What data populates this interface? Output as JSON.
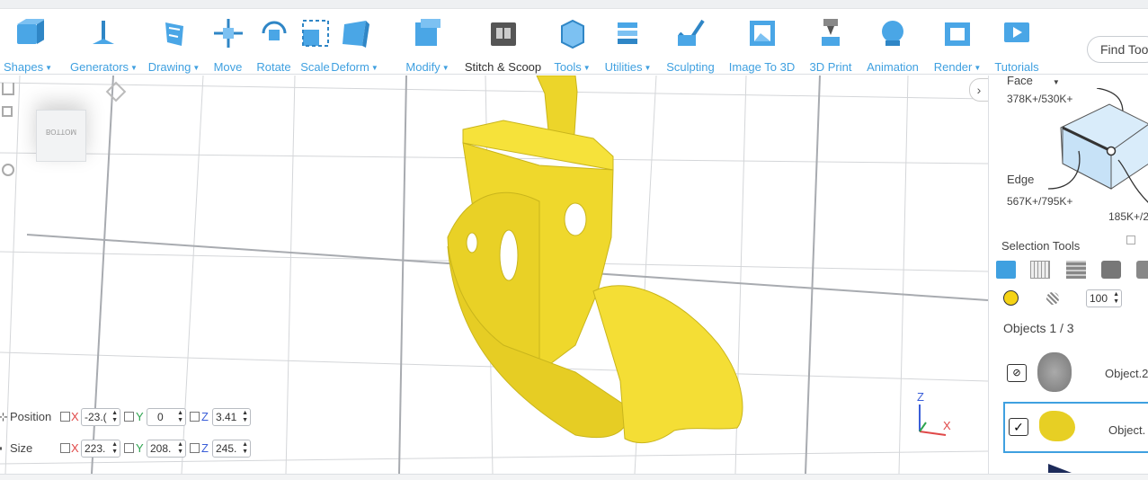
{
  "toolbar": {
    "items": [
      {
        "label": "Shapes",
        "dropdown": true,
        "icon": "cube-icon"
      },
      {
        "label": "Generators",
        "dropdown": true,
        "icon": "generator-icon"
      },
      {
        "label": "Drawing",
        "dropdown": true,
        "icon": "drawing-icon"
      },
      {
        "label": "Move",
        "dropdown": false,
        "icon": "move-icon"
      },
      {
        "label": "Rotate",
        "dropdown": false,
        "icon": "rotate-icon"
      },
      {
        "label": "Scale",
        "dropdown": false,
        "icon": "scale-icon"
      },
      {
        "label": "Deform",
        "dropdown": true,
        "icon": "deform-icon"
      },
      {
        "label": "Modify",
        "dropdown": true,
        "icon": "modify-icon"
      },
      {
        "label": "Stitch & Scoop",
        "dropdown": false,
        "icon": "stitch-scoop-icon"
      },
      {
        "label": "Tools",
        "dropdown": true,
        "icon": "tools-icon"
      },
      {
        "label": "Utilities",
        "dropdown": true,
        "icon": "utilities-icon"
      },
      {
        "label": "Sculpting",
        "dropdown": false,
        "icon": "sculpting-icon"
      },
      {
        "label": "Image To 3D",
        "dropdown": false,
        "icon": "image-to-3d-icon"
      },
      {
        "label": "3D Print",
        "dropdown": false,
        "icon": "3d-print-icon"
      },
      {
        "label": "Animation",
        "dropdown": false,
        "icon": "animation-icon"
      },
      {
        "label": "Render",
        "dropdown": true,
        "icon": "render-icon"
      },
      {
        "label": "Tutorials",
        "dropdown": false,
        "icon": "tutorials-icon"
      }
    ],
    "find_tool": "Find Too"
  },
  "viewport": {
    "view_cube_label": "BOTTOM",
    "position": {
      "label": "Position",
      "x": "-23.(",
      "y": "0",
      "z": "3.41"
    },
    "size": {
      "label": "Size",
      "x": "223.",
      "y": "208.",
      "z": "245."
    },
    "axis_labels": {
      "x": "X",
      "y": "Y",
      "z": "Z"
    },
    "gizmo": {
      "z": "Z",
      "x": "X"
    },
    "model_color": "#f2dc2c"
  },
  "panel": {
    "face_label": "Face",
    "face_count": "378K+/530K+",
    "edge_label": "Edge",
    "edge_count": "567K+/795K+",
    "vertex_count": "185K+/2",
    "selection_tools_label": "Selection Tools",
    "brush_size": "100",
    "objects_header": "Objects 1 / 3",
    "objects": [
      {
        "name": "Object.2",
        "checked": false,
        "hidden": true
      },
      {
        "name": "Object.",
        "checked": true,
        "hidden": false
      }
    ],
    "accent": "#3fa0e0"
  }
}
